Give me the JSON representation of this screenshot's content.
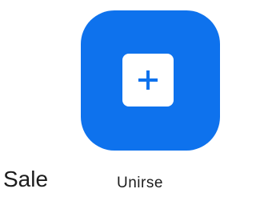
{
  "join": {
    "label": "Unirse",
    "icon": "plus-icon",
    "tile_color": "#0e72ed"
  },
  "side_label": "Sale"
}
